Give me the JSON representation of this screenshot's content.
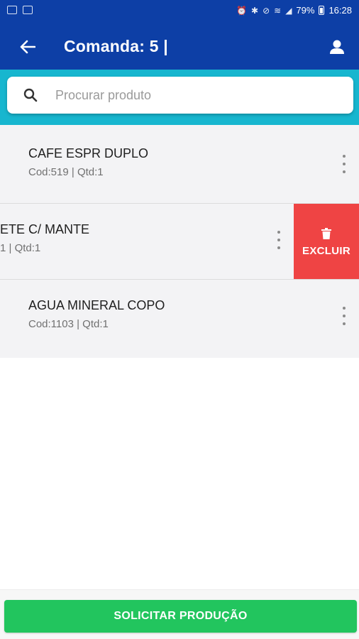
{
  "status_bar": {
    "battery": "79%",
    "time": "16:28",
    "icons": [
      "gallery-icon",
      "notification-icon",
      "alarm-icon",
      "bluetooth-icon",
      "mute-icon",
      "wifi-icon",
      "signal-icon",
      "battery-icon"
    ]
  },
  "app_bar": {
    "title": "Comanda: 5 |",
    "back_icon": "arrow-left-icon",
    "user_icon": "user-icon",
    "color": "#0d3fa6"
  },
  "search": {
    "placeholder": "Procurar produto",
    "value": "",
    "band_color": "#17b6cf"
  },
  "items": [
    {
      "name": "CAFE ESPR DUPLO",
      "meta": "Cod:519 | Qtd:1"
    },
    {
      "name": "ETE C/ MANTE",
      "meta": "1 | Qtd:1",
      "swiped": true,
      "delete_label": "EXCLUIR"
    },
    {
      "name": "AGUA MINERAL COPO",
      "meta": "Cod:1103 | Qtd:1"
    }
  ],
  "delete_color": "#ef4444",
  "primary_action": {
    "label": "SOLICITAR PRODUÇÃO",
    "color": "#22c55e"
  }
}
